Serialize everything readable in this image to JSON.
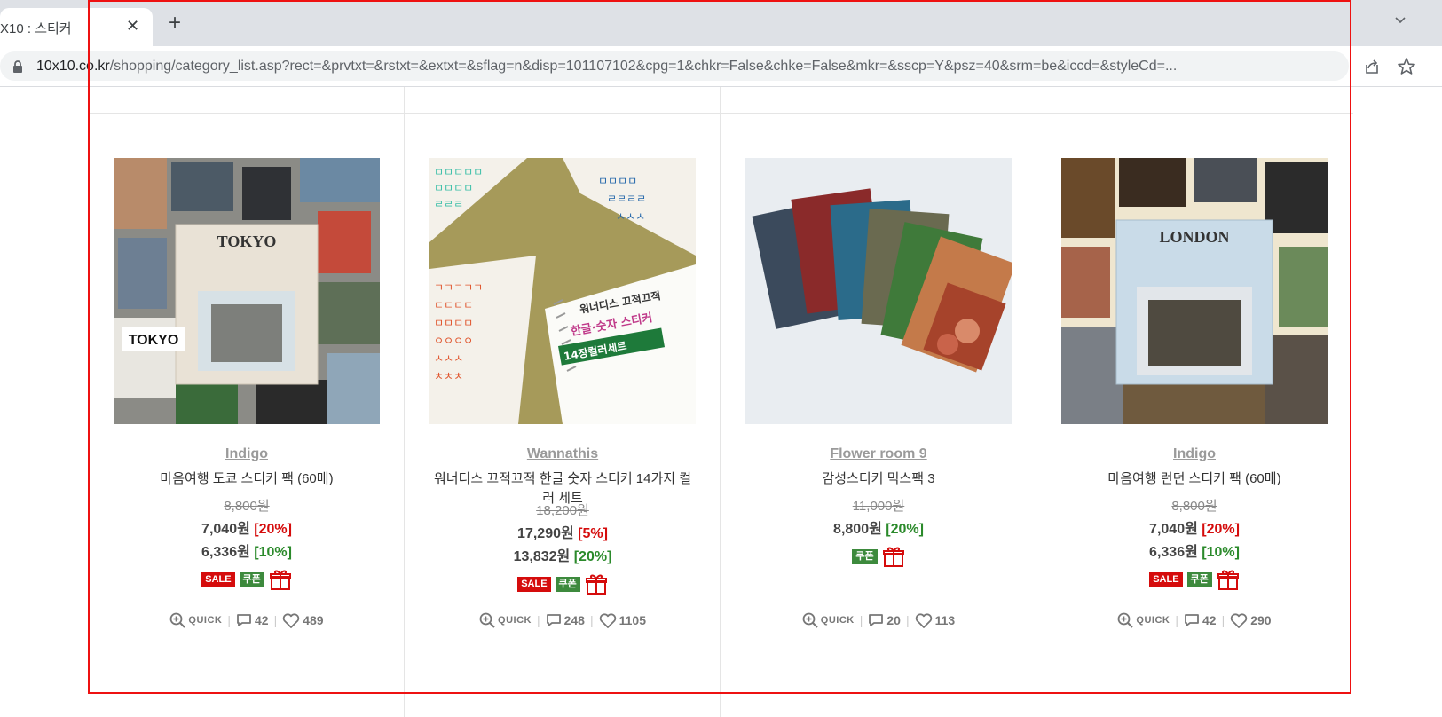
{
  "browser": {
    "tab_title": "X10 : 스티커",
    "tab_close": "✕",
    "new_tab": "+",
    "url_host": "10x10.co.kr",
    "url_path": "/shopping/category_list.asp?rect=&prvtxt=&rstxt=&extxt=&sflag=n&disp=101107102&cpg=1&chkr=False&chke=False&mkr=&sscp=Y&psz=40&srm=be&iccd=&styleCd=..."
  },
  "colors": {
    "sale_red": "#d50c0c",
    "coupon_green": "#3d8a3d",
    "frame_red": "#ee1111"
  },
  "products": [
    {
      "brand": "Indigo",
      "name": "마음여행 도쿄 스티커 팩 (60매)",
      "original_price": "8,800원",
      "sale_price": "7,040원",
      "sale_pct": "[20%]",
      "coupon_price": "6,336원",
      "coupon_pct": "[10%]",
      "badge_sale": "SALE",
      "badge_coupon": "쿠폰",
      "quick": "QUICK",
      "reviews": "42",
      "likes": "489",
      "thumb_label": "TOKYO"
    },
    {
      "brand": "Wannathis",
      "name": "워너디스 끄적끄적 한글 숫자 스티커 14가지 컬러 세트",
      "original_price": "18,200원",
      "sale_price": "17,290원",
      "sale_pct": "[5%]",
      "coupon_price": "13,832원",
      "coupon_pct": "[20%]",
      "badge_sale": "SALE",
      "badge_coupon": "쿠폰",
      "quick": "QUICK",
      "reviews": "248",
      "likes": "1105",
      "thumb_label": "워너디스 끄적끄적 한글·숫자 스티커 14장컬러세트"
    },
    {
      "brand": "Flower room 9",
      "name": "감성스티커 믹스팩 3",
      "original_price": "11,000원",
      "sale_price": "8,800원",
      "sale_pct": "[20%]",
      "badge_coupon": "쿠폰",
      "quick": "QUICK",
      "reviews": "20",
      "likes": "113"
    },
    {
      "brand": "Indigo",
      "name": "마음여행 런던 스티커 팩 (60매)",
      "original_price": "8,800원",
      "sale_price": "7,040원",
      "sale_pct": "[20%]",
      "coupon_price": "6,336원",
      "coupon_pct": "[10%]",
      "badge_sale": "SALE",
      "badge_coupon": "쿠폰",
      "quick": "QUICK",
      "reviews": "42",
      "likes": "290",
      "thumb_label": "LONDON"
    }
  ]
}
